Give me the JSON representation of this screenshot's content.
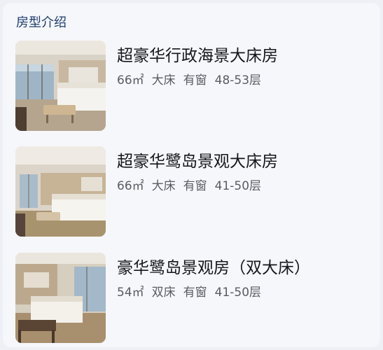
{
  "section": {
    "title": "房型介绍"
  },
  "rooms": [
    {
      "name": "超豪华行政海景大床房",
      "area": "66㎡",
      "bed": "大床",
      "window": "有窗",
      "floors": "48-53层"
    },
    {
      "name": "超豪华鹭岛景观大床房",
      "area": "66㎡",
      "bed": "大床",
      "window": "有窗",
      "floors": "41-50层"
    },
    {
      "name": "豪华鹭岛景观房（双大床）",
      "area": "54㎡",
      "bed": "双床",
      "window": "有窗",
      "floors": "41-50层"
    }
  ]
}
